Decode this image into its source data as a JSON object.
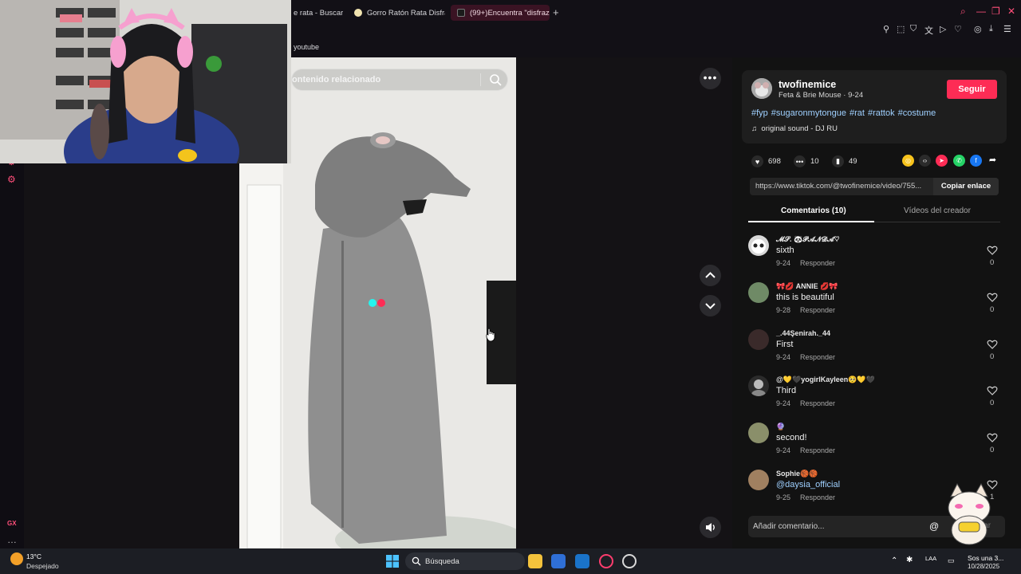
{
  "browser": {
    "tabs": [
      {
        "label": "e rata - Buscar c"
      },
      {
        "label": "Gorro Ratón Rata Disfraz"
      },
      {
        "label": "(99+)Encuentra \"disfraz c"
      }
    ],
    "bookmark": "youtube"
  },
  "video": {
    "search_placeholder": "ontenido relacionado"
  },
  "post": {
    "username": "twofinemice",
    "subtitle": "Feta & Brie Mouse · 9-24",
    "follow_label": "Seguir",
    "hashtags": [
      "#fyp",
      "#sugaronmytongue",
      "#rat",
      "#rattok",
      "#costume"
    ],
    "sound": "original sound - DJ RU",
    "likes": "698",
    "comments": "10",
    "saves": "49",
    "link": "https://www.tiktok.com/@twofinemice/video/755...",
    "copy_label": "Copiar enlace",
    "tab_comments": "Comentarios (10)",
    "tab_videos": "Vídeos del creador"
  },
  "comments": [
    {
      "user": "𝓜𝓢. 🐼𝓟𝓐𝓝𝓓𝓐♡",
      "text": "sixth",
      "date": "9-24",
      "reply": "Responder",
      "likes": "0",
      "avatar_color": "#d8d8d8"
    },
    {
      "user": "🎀💋 ANNIE 💋🎀",
      "text": "this is beautiful",
      "date": "9-28",
      "reply": "Responder",
      "likes": "0",
      "avatar_color": "#6f8a66"
    },
    {
      "user": "_.44Şenirah._44",
      "text": "First",
      "date": "9-24",
      "reply": "Responder",
      "likes": "0",
      "avatar_color": "#3a2a2a"
    },
    {
      "user": "@💛🖤yogirlKayleen🥺💛🖤",
      "text": "Third",
      "date": "9-24",
      "reply": "Responder",
      "likes": "0",
      "avatar_color": "#2b2b2b"
    },
    {
      "user": "🔮",
      "text": "second!",
      "date": "9-24",
      "reply": "Responder",
      "likes": "0",
      "avatar_color": "#8a8f6a"
    },
    {
      "user": "Sophie🏀🏀",
      "text": "@daysia_official",
      "date": "9-25",
      "reply": "Responder",
      "likes": "1",
      "avatar_color": "#a08060"
    }
  ],
  "comment_box": {
    "placeholder": "Añadir comentario...",
    "mention": "@",
    "post_label": "icar"
  },
  "taskbar": {
    "temp": "13°C",
    "weather": "Despejado",
    "search": "Búsqueda",
    "lang": "LAA",
    "time": "Sos una 3...",
    "date": "10/28/2025"
  },
  "colors": {
    "accent": "#fe2c55",
    "gx_pink": "#ff4f7a",
    "link_blue": "#9fd0ff"
  }
}
